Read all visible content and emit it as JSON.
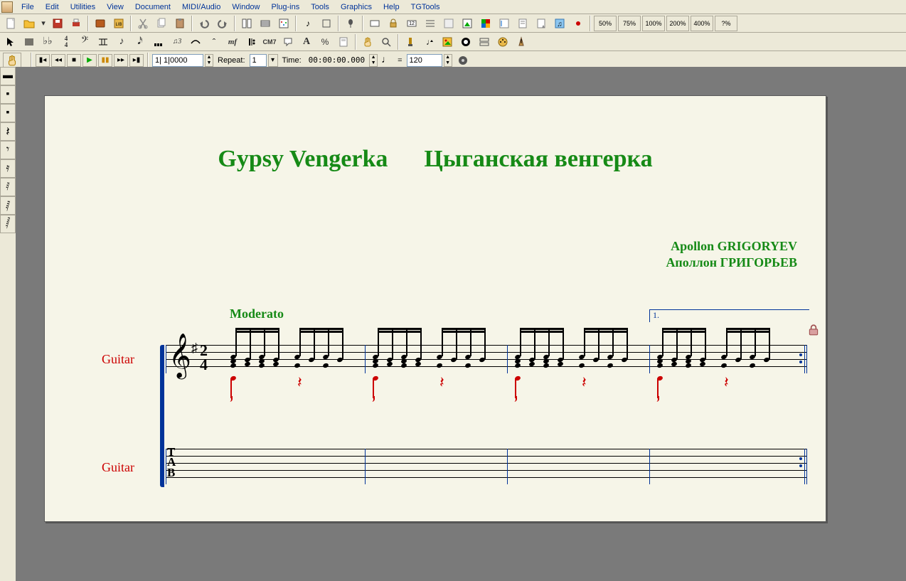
{
  "menu": [
    "File",
    "Edit",
    "Utilities",
    "View",
    "Document",
    "MIDI/Audio",
    "Window",
    "Plug-ins",
    "Tools",
    "Graphics",
    "Help",
    "TGTools"
  ],
  "zoom_levels": [
    "50%",
    "75%",
    "100%",
    "200%",
    "400%",
    "?%"
  ],
  "transport": {
    "measure_display": "1| 1|0000",
    "repeat_label": "Repeat:",
    "repeat_value": "1",
    "time_label": "Time:",
    "time_value": "00:00:00.000",
    "tempo_equals": "=",
    "tempo_value": "120"
  },
  "score": {
    "title_en": "Gypsy Vengerka",
    "title_ru": "Цыганская венгерка",
    "composer_en": "Apollon GRIGORYEV",
    "composer_ru": "Аполлон ГРИГОРЬЕВ",
    "tempo_mark": "Moderato",
    "ending_label": "1.",
    "staff1_label": "Guitar",
    "staff2_label": "Guitar",
    "time_sig_top": "2",
    "time_sig_bottom": "4",
    "tab_letters": [
      "T",
      "A",
      "B"
    ]
  }
}
